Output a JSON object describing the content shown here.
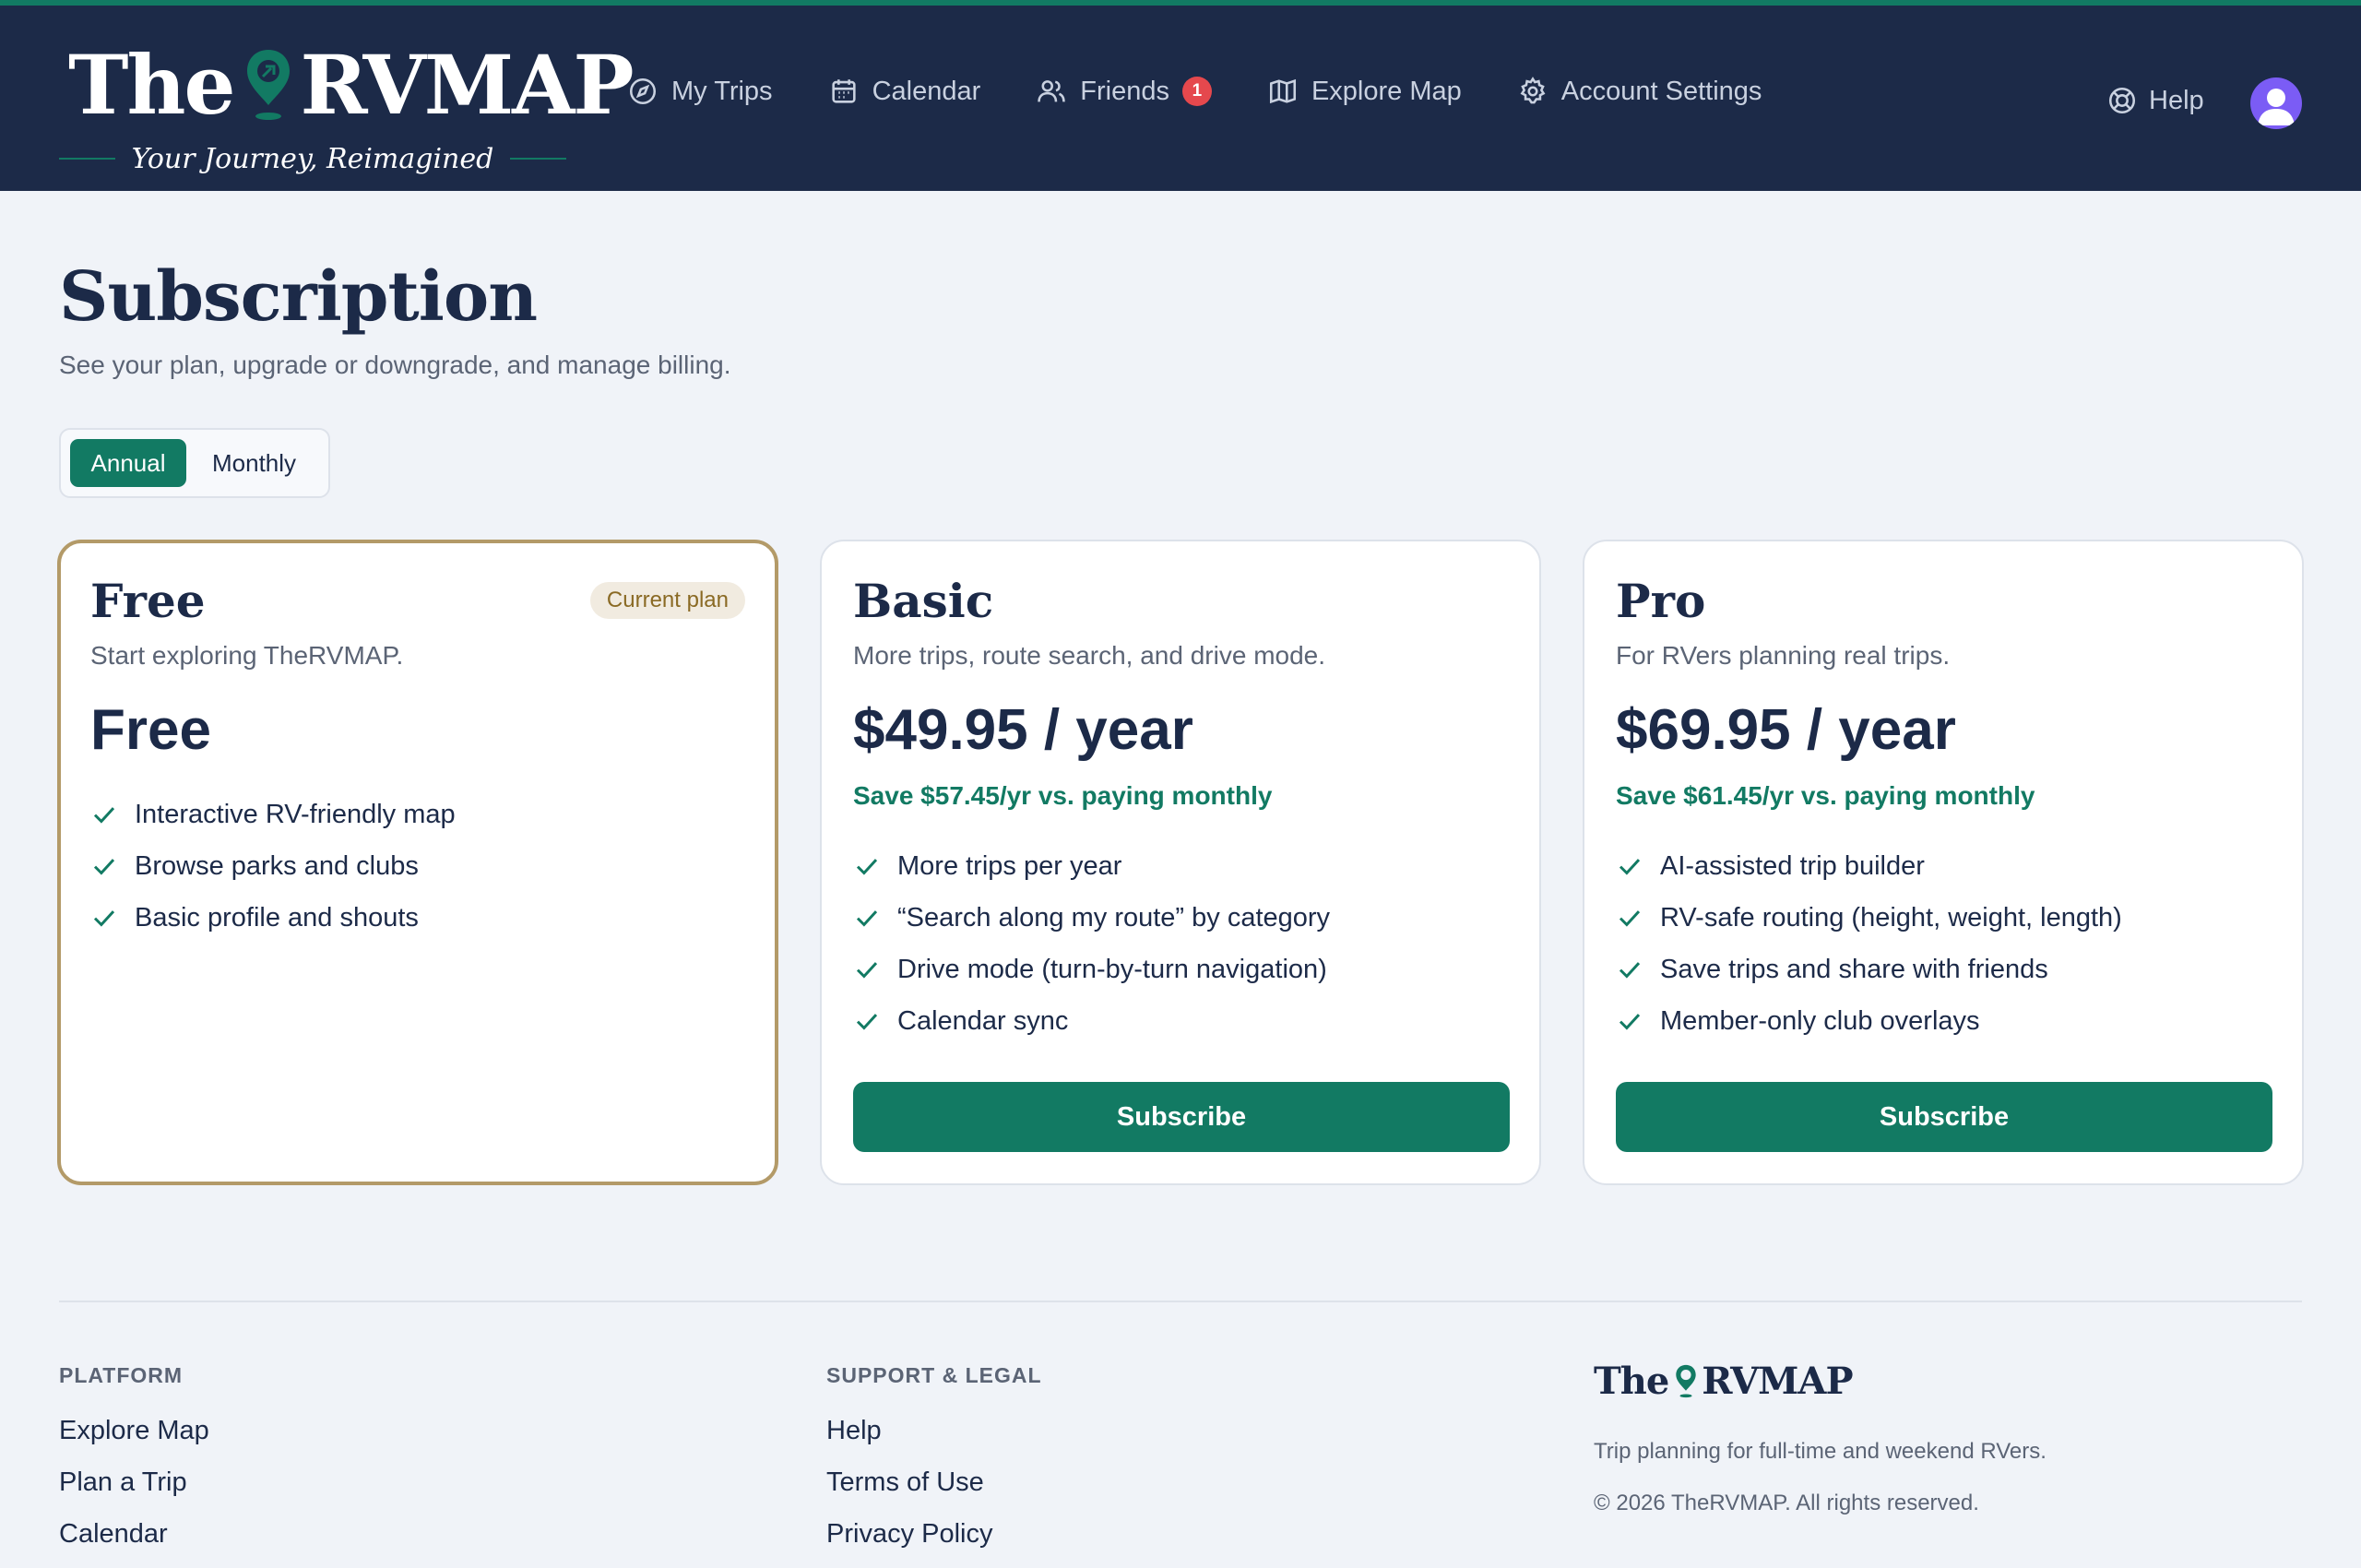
{
  "brand": {
    "name_left": "The",
    "name_right": "RVMAP",
    "tagline": "Your Journey, Reimagined",
    "accent_color": "#127a63",
    "header_color": "#1c2a48"
  },
  "nav": {
    "items": [
      {
        "label": "My Trips",
        "icon": "compass-icon"
      },
      {
        "label": "Calendar",
        "icon": "calendar-icon"
      },
      {
        "label": "Friends",
        "icon": "users-icon",
        "badge": "1"
      },
      {
        "label": "Explore Map",
        "icon": "map-icon"
      },
      {
        "label": "Account Settings",
        "icon": "gear-icon"
      }
    ],
    "help_label": "Help"
  },
  "page": {
    "title": "Subscription",
    "subtitle": "See your plan, upgrade or downgrade, and manage billing."
  },
  "billing_toggle": {
    "options": [
      "Annual",
      "Monthly"
    ],
    "selected": "Annual"
  },
  "plans": [
    {
      "name": "Free",
      "description": "Start exploring TheRVMAP.",
      "price": "Free",
      "savings": "",
      "current_badge": "Current plan",
      "features": [
        "Interactive RV-friendly map",
        "Browse parks and clubs",
        "Basic profile and shouts"
      ]
    },
    {
      "name": "Basic",
      "description": "More trips, route search, and drive mode.",
      "price": "$49.95 / year",
      "savings": "Save $57.45/yr vs. paying monthly",
      "features": [
        "More trips per year",
        "“Search along my route” by category",
        "Drive mode (turn-by-turn navigation)",
        "Calendar sync"
      ],
      "button_label": "Subscribe"
    },
    {
      "name": "Pro",
      "description": "For RVers planning real trips.",
      "price": "$69.95 / year",
      "savings": "Save $61.45/yr vs. paying monthly",
      "features": [
        "AI-assisted trip builder",
        "RV-safe routing (height, weight, length)",
        "Save trips and share with friends",
        "Member-only club overlays"
      ],
      "button_label": "Subscribe"
    }
  ],
  "footer": {
    "platform": {
      "heading": "PLATFORM",
      "links": [
        "Explore Map",
        "Plan a Trip",
        "Calendar"
      ]
    },
    "support": {
      "heading": "SUPPORT & LEGAL",
      "links": [
        "Help",
        "Terms of Use",
        "Privacy Policy"
      ]
    },
    "brand_left": "The",
    "brand_right": "RVMAP",
    "tagline": "Trip planning for full-time and weekend RVers.",
    "copyright": "© 2026 TheRVMAP. All rights reserved."
  }
}
